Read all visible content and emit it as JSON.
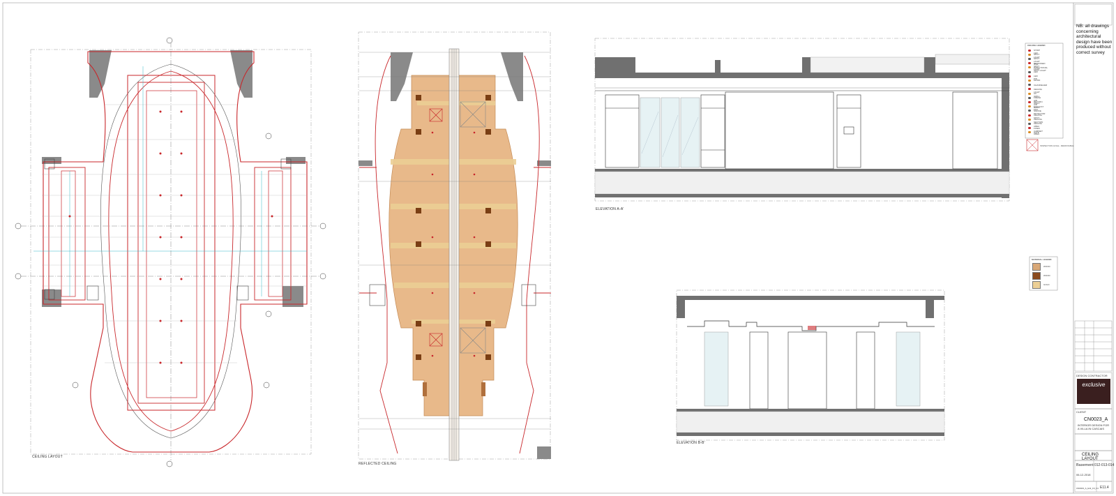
{
  "drawings": {
    "plan_left_label": "CEILING LAYOUT",
    "plan_mid_label": "REFLECTED CEILING",
    "elevation_a_label": "ELEVATION A-A'",
    "elevation_b_label": "ELEVATION B-B'"
  },
  "notes": {
    "nb": "NB: all drawings concerning architectural design have been produced without correct survey"
  },
  "ceiling_legend": {
    "title": "CEILING LEGEND",
    "items": [
      "STRIP LED",
      "SPOT LIGHT",
      "SPOT LIGHT IP44",
      "RECESSED SPOT LIGHT",
      "DIRECTIONAL SPOT LIGHT",
      "LED",
      "LED PIN",
      "MOOD",
      "CHANDELIER",
      "CEILING LIGHT",
      "AC GRILL",
      "FRESH AIR GRILL",
      "RETURN AIR GRILL",
      "EXHAUST FAN",
      "SMOKE DETECTOR",
      "CEILING SPOT",
      "CEILING SECTION",
      "CEILING AREA",
      "FIXED CABINET AREA",
      "HATE"
    ],
    "extra": "INSPECTION HOLE - REMOVABLE"
  },
  "material_legend": {
    "title": "MATERIAL LEGEND",
    "items": [
      {
        "label": "WOOD",
        "color": "#d9a877"
      },
      {
        "label": "WOOD",
        "color": "#8a4a1e"
      },
      {
        "label": "GOLD",
        "color": "#eccf95"
      }
    ]
  },
  "title_block": {
    "design_contractor": "DESIGN CONTRACTOR",
    "logo_text": "exclusive",
    "client_label": "CLIENT",
    "client": "CN0023_A",
    "project": "INTERIOR DESIGN FOR A VILLA IN CASCAIS",
    "drawing_title": "CEILING LAYOUT",
    "level": "Basement",
    "sheet_no": "012-013-014",
    "date": "06-12-2018",
    "code": "E11.4",
    "file": "CN0023_A_E11_F3_F4"
  },
  "colors": {
    "red": "#c8262a",
    "wall": "#6f6f6f",
    "cyan": "#34b8c7",
    "wood_light": "#e8b98a",
    "wood_dark": "#7a3e14"
  }
}
